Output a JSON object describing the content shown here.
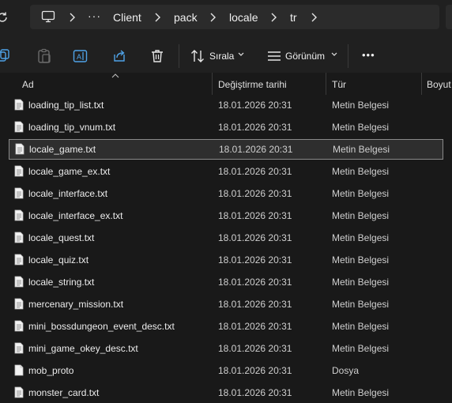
{
  "address_bar": {
    "more_label": "···",
    "breadcrumbs": [
      "Client",
      "pack",
      "locale",
      "tr"
    ]
  },
  "command_bar": {
    "sort_label": "Sırala",
    "view_label": "Görünüm",
    "more_label": "•••"
  },
  "columns": {
    "name": "Ad",
    "date": "Değiştirme tarihi",
    "type": "Tür",
    "size": "Boyut"
  },
  "files": [
    {
      "name": "loading_tip_list.txt",
      "date": "18.01.2026 20:31",
      "type": "Metin Belgesi",
      "selected": false
    },
    {
      "name": "loading_tip_vnum.txt",
      "date": "18.01.2026 20:31",
      "type": "Metin Belgesi",
      "selected": false
    },
    {
      "name": "locale_game.txt",
      "date": "18.01.2026 20:31",
      "type": "Metin Belgesi",
      "selected": true
    },
    {
      "name": "locale_game_ex.txt",
      "date": "18.01.2026 20:31",
      "type": "Metin Belgesi",
      "selected": false
    },
    {
      "name": "locale_interface.txt",
      "date": "18.01.2026 20:31",
      "type": "Metin Belgesi",
      "selected": false
    },
    {
      "name": "locale_interface_ex.txt",
      "date": "18.01.2026 20:31",
      "type": "Metin Belgesi",
      "selected": false
    },
    {
      "name": "locale_quest.txt",
      "date": "18.01.2026 20:31",
      "type": "Metin Belgesi",
      "selected": false
    },
    {
      "name": "locale_quiz.txt",
      "date": "18.01.2026 20:31",
      "type": "Metin Belgesi",
      "selected": false
    },
    {
      "name": "locale_string.txt",
      "date": "18.01.2026 20:31",
      "type": "Metin Belgesi",
      "selected": false
    },
    {
      "name": "mercenary_mission.txt",
      "date": "18.01.2026 20:31",
      "type": "Metin Belgesi",
      "selected": false
    },
    {
      "name": "mini_bossdungeon_event_desc.txt",
      "date": "18.01.2026 20:31",
      "type": "Metin Belgesi",
      "selected": false
    },
    {
      "name": "mini_game_okey_desc.txt",
      "date": "18.01.2026 20:31",
      "type": "Metin Belgesi",
      "selected": false
    },
    {
      "name": "mob_proto",
      "date": "18.01.2026 20:31",
      "type": "Dosya",
      "selected": false
    },
    {
      "name": "monster_card.txt",
      "date": "18.01.2026 20:31",
      "type": "Metin Belgesi",
      "selected": false
    }
  ]
}
